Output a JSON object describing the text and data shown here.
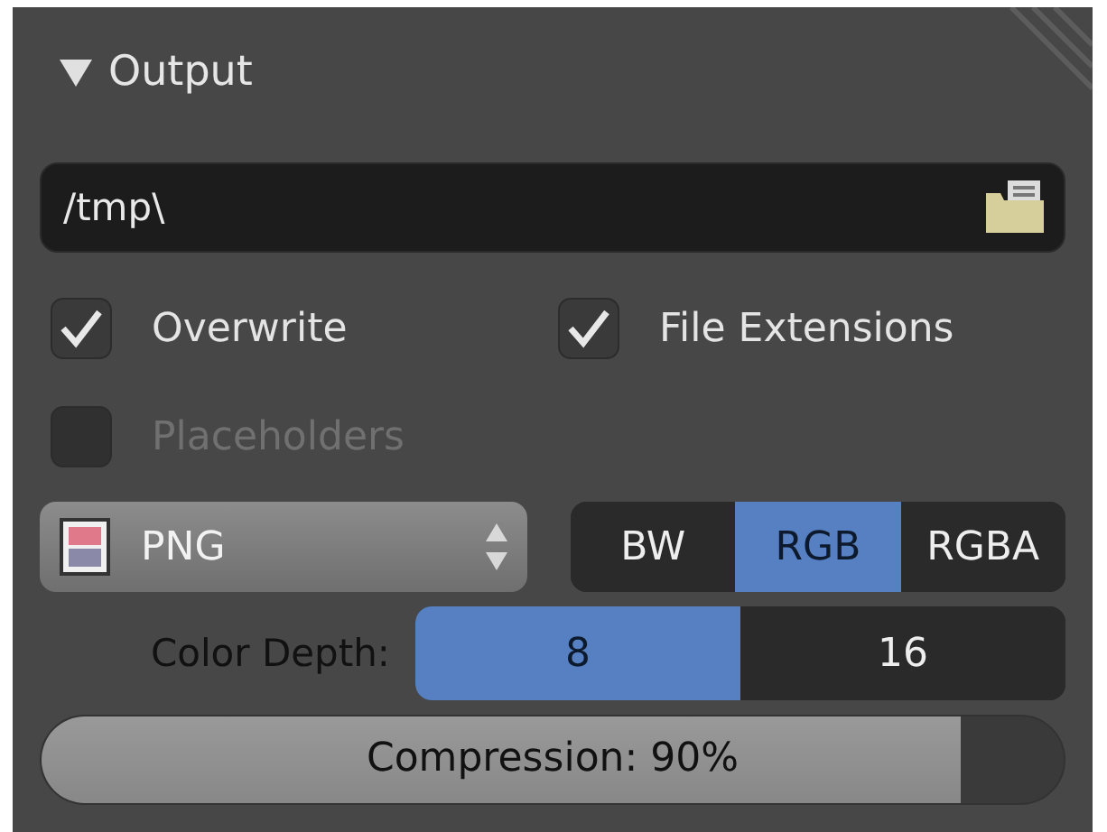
{
  "panel": {
    "title": "Output",
    "expanded": true
  },
  "path_field": {
    "value": "/tmp\\"
  },
  "checkboxes": [
    {
      "label": "Overwrite",
      "checked": true,
      "disabled": false
    },
    {
      "label": "File Extensions",
      "checked": true,
      "disabled": false
    },
    {
      "label": "Placeholders",
      "checked": false,
      "disabled": true
    }
  ],
  "format": {
    "value": "PNG"
  },
  "color_modes": [
    {
      "label": "BW",
      "selected": false
    },
    {
      "label": "RGB",
      "selected": true
    },
    {
      "label": "RGBA",
      "selected": false
    }
  ],
  "color_depth": {
    "label": "Color Depth:",
    "options": [
      {
        "label": "8",
        "selected": true
      },
      {
        "label": "16",
        "selected": false
      }
    ]
  },
  "compression": {
    "text": "Compression: 90%",
    "level": 0.9
  }
}
